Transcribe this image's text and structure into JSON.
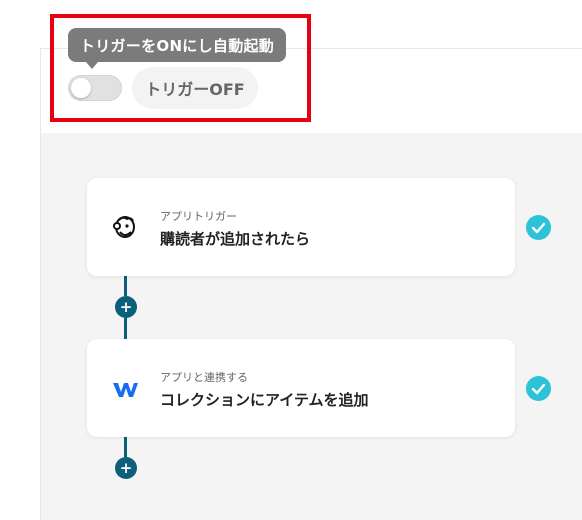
{
  "trigger": {
    "tooltip_text": "トリガーをONにし自動起動",
    "status_label": "トリガーOFF",
    "toggle_on": false
  },
  "steps": [
    {
      "subtitle": "アプリトリガー",
      "title": "購読者が追加されたら",
      "icon": "mailchimp-icon",
      "completed": true
    },
    {
      "subtitle": "アプリと連携する",
      "title": "コレクションにアイテムを追加",
      "icon": "webflow-icon",
      "completed": true
    }
  ],
  "colors": {
    "highlight": "#e60012",
    "connector": "#0c5f7a",
    "check": "#2cc3d8"
  }
}
